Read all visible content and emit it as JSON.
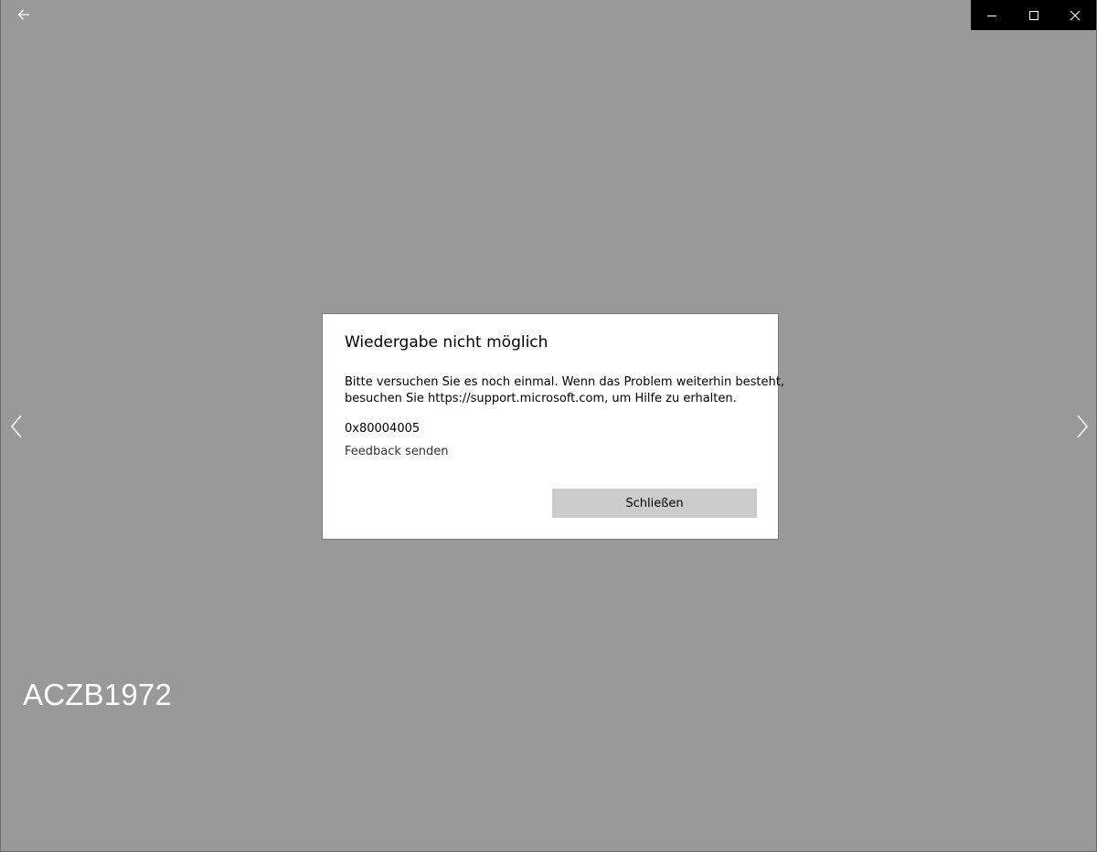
{
  "window": {
    "background_color": "#999999",
    "caption_bar_color": "#000000"
  },
  "header": {
    "back_icon": "back-arrow-icon",
    "caption_icons": [
      "minimize-icon",
      "maximize-icon",
      "close-icon"
    ]
  },
  "navigation": {
    "prev_icon": "chevron-left-icon",
    "next_icon": "chevron-right-icon"
  },
  "media": {
    "title": "ACZB1972"
  },
  "dialog": {
    "title": "Wiedergabe nicht möglich",
    "message_line1": "Bitte versuchen Sie es noch einmal. Wenn das Problem weiterhin besteht,",
    "message_line2": "besuchen Sie https://support.microsoft.com, um Hilfe zu erhalten.",
    "error_code": "0x80004005",
    "feedback_link": "Feedback senden",
    "close_button": "Schließen",
    "close_button_color": "#cccccc"
  }
}
